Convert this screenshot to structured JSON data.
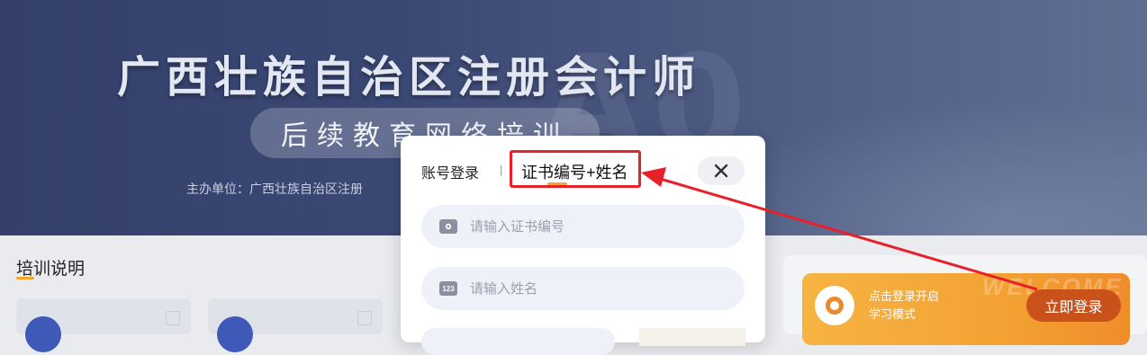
{
  "banner": {
    "title": "广西壮族自治区注册会计师",
    "subtitle": "后续教育网络培训",
    "host": "主办单位：广西壮族自治区注册"
  },
  "training": {
    "title": "培训说明"
  },
  "login_modal": {
    "tab_account": "账号登录",
    "tab_separator": "|",
    "tab_cert": "证书编号+姓名",
    "close_icon": "close-icon",
    "cert_field": {
      "placeholder": "请输入证书编号",
      "value": "",
      "icon": "id-card-icon"
    },
    "name_field": {
      "placeholder": "请输入姓名",
      "value": "",
      "icon": "number-123-icon",
      "icon_text": "123"
    }
  },
  "welcome": {
    "tip_line1": "点击登录开启",
    "tip_line2": "学习模式",
    "login_button": "立即登录"
  },
  "colors": {
    "accent_orange": "#f5a623",
    "annotation_red": "#e8202a",
    "login_button": "#c9521b"
  }
}
